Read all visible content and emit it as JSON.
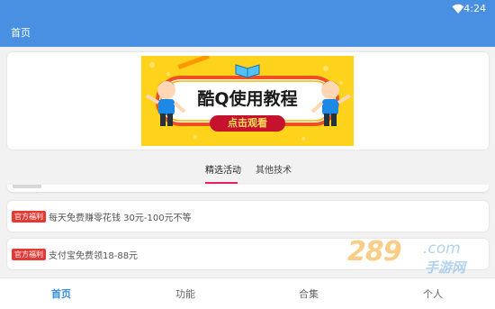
{
  "status_bar": {
    "time": "4:24",
    "wifi_icon": "wifi-icon"
  },
  "app_bar": {
    "title": "首页"
  },
  "banner": {
    "title": "酷Q使用教程",
    "button": "点击观看",
    "colors": {
      "background": "#ffd21c",
      "button": "#c4122f"
    }
  },
  "tabs": [
    {
      "label": "精选活动",
      "active": true
    },
    {
      "label": "其他技术",
      "active": false
    }
  ],
  "list": [
    {
      "badge": "官方福利",
      "text": "每天免费赚零花钱 30元-100元不等"
    },
    {
      "badge": "官方福利",
      "text": "支付宝免费领18-88元"
    }
  ],
  "watermark": {
    "brand": "289",
    "domain": ".com",
    "subtitle": "手游网"
  },
  "bottom_nav": [
    {
      "label": "首页",
      "active": true
    },
    {
      "label": "功能",
      "active": false
    },
    {
      "label": "合集",
      "active": false
    },
    {
      "label": "个人",
      "active": false
    }
  ],
  "colors": {
    "primary": "#4a90e2",
    "accent": "#e91e63",
    "badge": "#e53935",
    "nav_active": "#3a8ee6"
  }
}
